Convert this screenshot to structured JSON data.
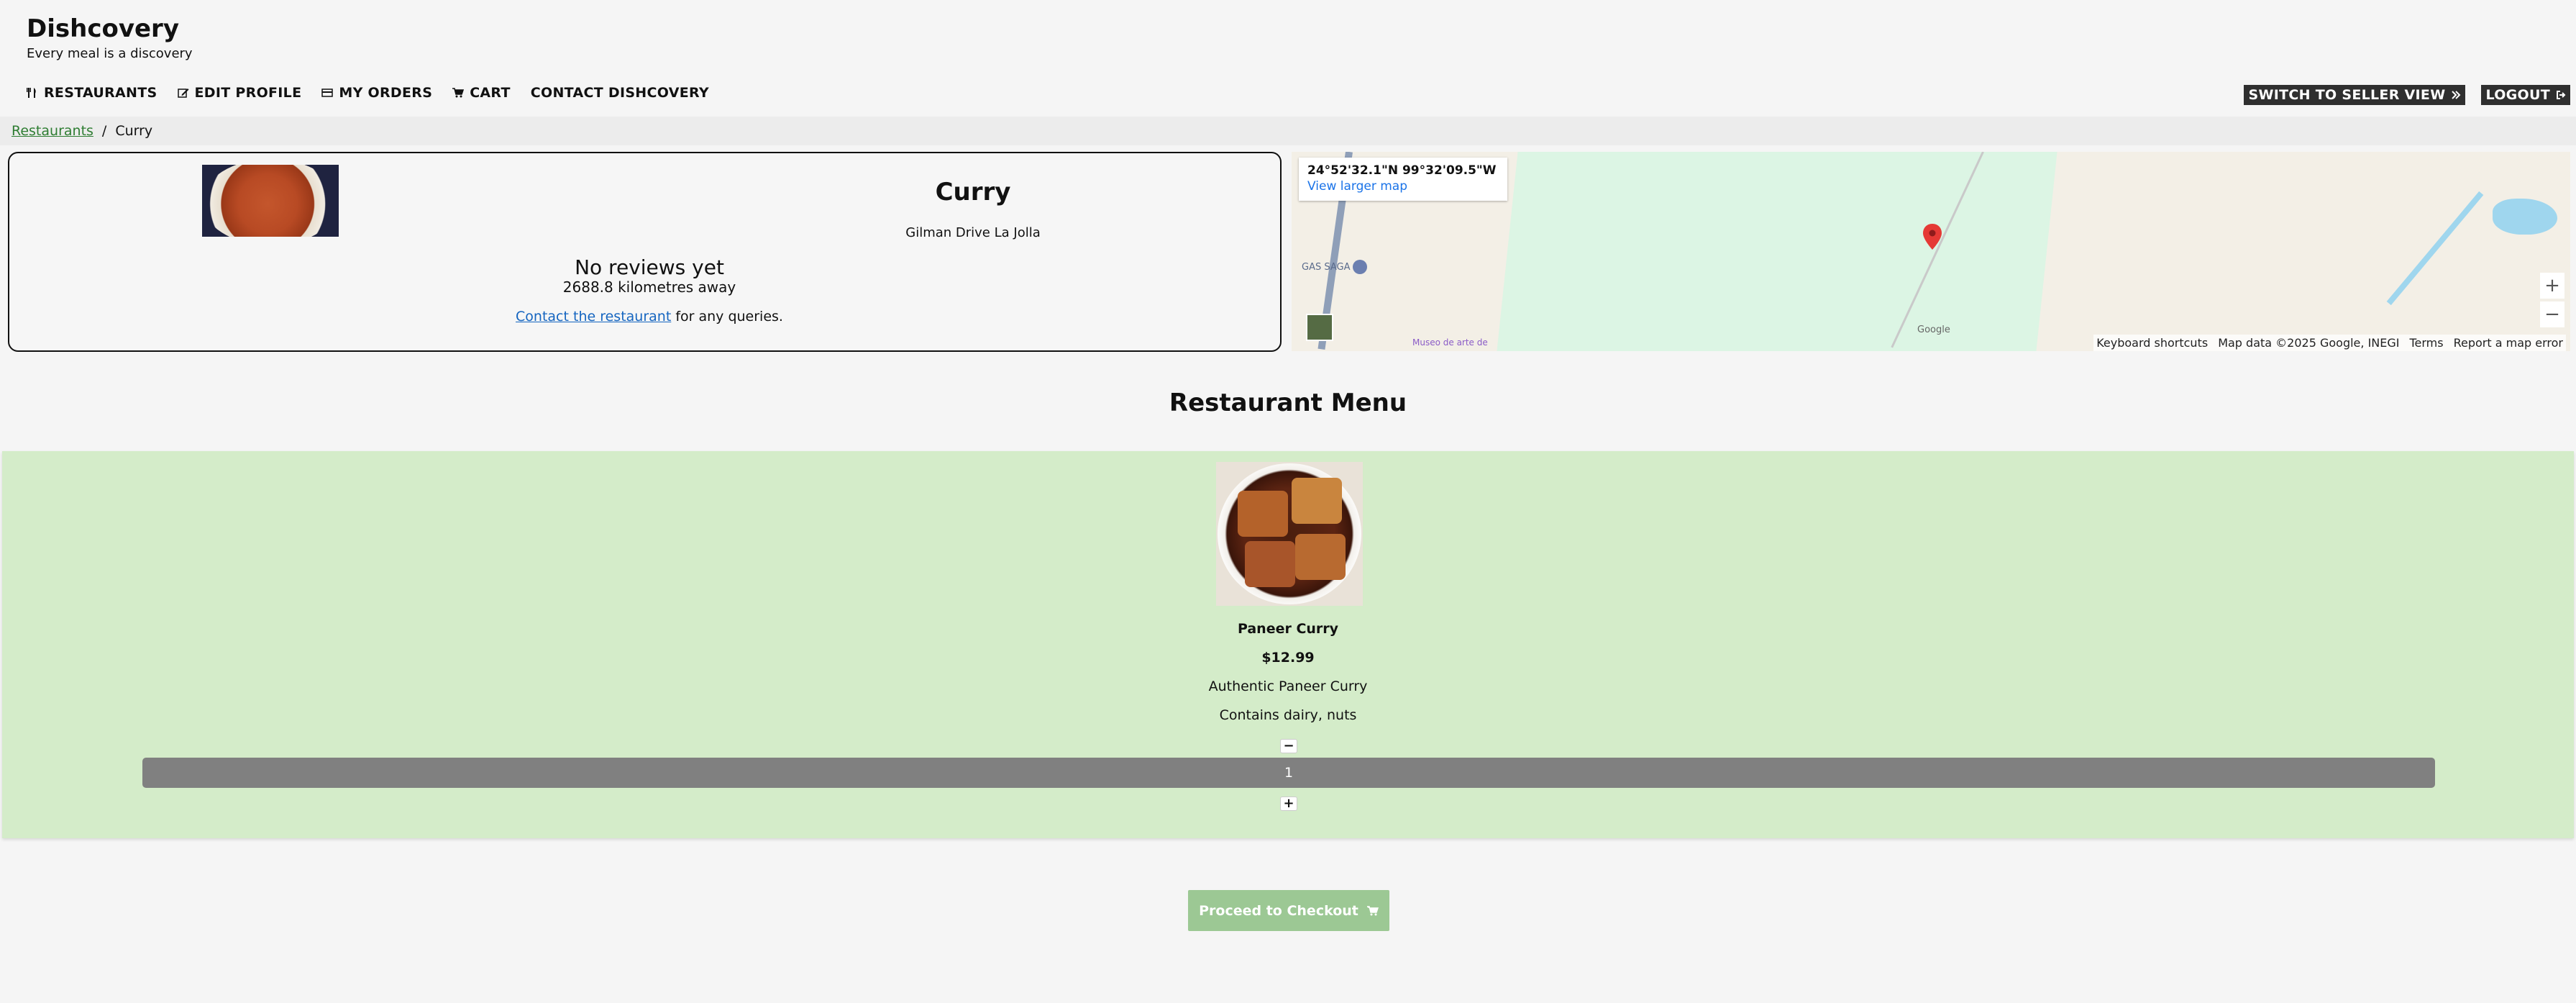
{
  "brand": {
    "title": "Dishcovery",
    "tagline": "Every meal is a discovery"
  },
  "nav": {
    "items": [
      {
        "label": "RESTAURANTS",
        "icon": "utensils-icon"
      },
      {
        "label": "EDIT PROFILE",
        "icon": "edit-icon"
      },
      {
        "label": "MY ORDERS",
        "icon": "credit-card-icon"
      },
      {
        "label": "CART",
        "icon": "cart-icon"
      },
      {
        "label": "CONTACT DISHCOVERY",
        "icon": ""
      }
    ],
    "seller_view": "SWITCH TO SELLER VIEW",
    "logout": "LOGOUT"
  },
  "breadcrumb": {
    "root": "Restaurants",
    "separator": "/",
    "current": "Curry"
  },
  "restaurant": {
    "name": "Curry",
    "address": "Gilman Drive La Jolla",
    "reviews": "No reviews yet",
    "distance": "2688.8 kilometres away",
    "contact_link": "Contact the restaurant",
    "contact_suffix": " for any queries."
  },
  "map": {
    "coords": "24°52'32.1\"N 99°32'09.5\"W",
    "larger_map": "View larger map",
    "poi_gas": "GAS SAGA",
    "poi_museum": "Museo de arte de",
    "google": "Google",
    "zoom_in": "+",
    "zoom_out": "−",
    "footer": {
      "shortcuts": "Keyboard shortcuts",
      "data": "Map data ©2025 Google, INEGI",
      "terms": "Terms",
      "report": "Report a map error"
    }
  },
  "menu": {
    "title": "Restaurant Menu",
    "items": [
      {
        "name": "Paneer Curry",
        "price": "$12.99",
        "description": "Authentic Paneer Curry",
        "allergens": "Contains dairy, nuts",
        "quantity": "1",
        "minus": "−",
        "plus": "+"
      }
    ]
  },
  "checkout": {
    "label": "Proceed to Checkout"
  },
  "colors": {
    "accent_green": "#9cc894",
    "panel_green": "#d4ecc9",
    "link_green": "#2e7d32",
    "link_blue": "#1565c0",
    "dark_button": "#2f2f2f",
    "quantity_bar": "#808080"
  }
}
